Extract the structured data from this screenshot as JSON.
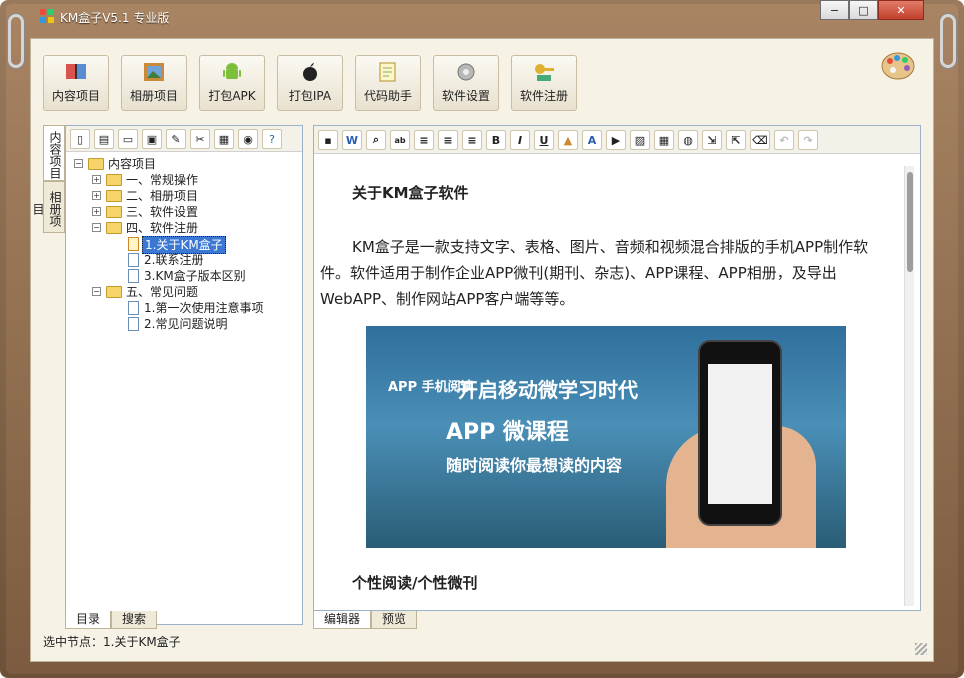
{
  "window": {
    "title": "KM盒子V5.1 专业版",
    "controls": {
      "minimize": "−",
      "maximize": "□",
      "close": "✕"
    }
  },
  "toolbar": {
    "buttons": [
      {
        "label": "内容项目",
        "icon": "book-icon"
      },
      {
        "label": "相册项目",
        "icon": "photo-icon"
      },
      {
        "label": "打包APK",
        "icon": "android-icon"
      },
      {
        "label": "打包IPA",
        "icon": "apple-icon"
      },
      {
        "label": "代码助手",
        "icon": "notepad-icon"
      },
      {
        "label": "软件设置",
        "icon": "gear-icon"
      },
      {
        "label": "软件注册",
        "icon": "key-icon"
      }
    ]
  },
  "left_tabs": {
    "content": "内容项目",
    "album": "相册项目"
  },
  "tree": {
    "root": "内容项目",
    "nodes": [
      {
        "label": "一、常规操作"
      },
      {
        "label": "二、相册项目"
      },
      {
        "label": "三、软件设置"
      },
      {
        "label": "四、软件注册"
      },
      {
        "label": "1.关于KM盒子"
      },
      {
        "label": "2.联系注册"
      },
      {
        "label": "3.KM盒子版本区别"
      },
      {
        "label": "五、常见问题"
      },
      {
        "label": "1.第一次使用注意事项"
      },
      {
        "label": "2.常见问题说明"
      }
    ]
  },
  "left_bottom_tabs": {
    "catalog": "目录",
    "search": "搜索"
  },
  "editor": {
    "heading": "关于KM盒子软件",
    "paragraph": "KM盒子是一款支持文字、表格、图片、音频和视频混合排版的手机APP制作软件。软件适用于制作企业APP微刊(期刊、杂志)、APP课程、APP相册，及导出WebAPP、制作网站APP客户端等等。",
    "banner": {
      "app_logo": "APP 手机阅读",
      "line1": "开启移动微学习时代",
      "line2": "APP 微课程",
      "line3": "随时阅读你最想读的内容"
    },
    "heading2": "个性阅读/个性微刊"
  },
  "right_bottom_tabs": {
    "editor": "编辑器",
    "preview": "预览"
  },
  "status": {
    "text": "选中节点：1.关于KM盒子"
  }
}
